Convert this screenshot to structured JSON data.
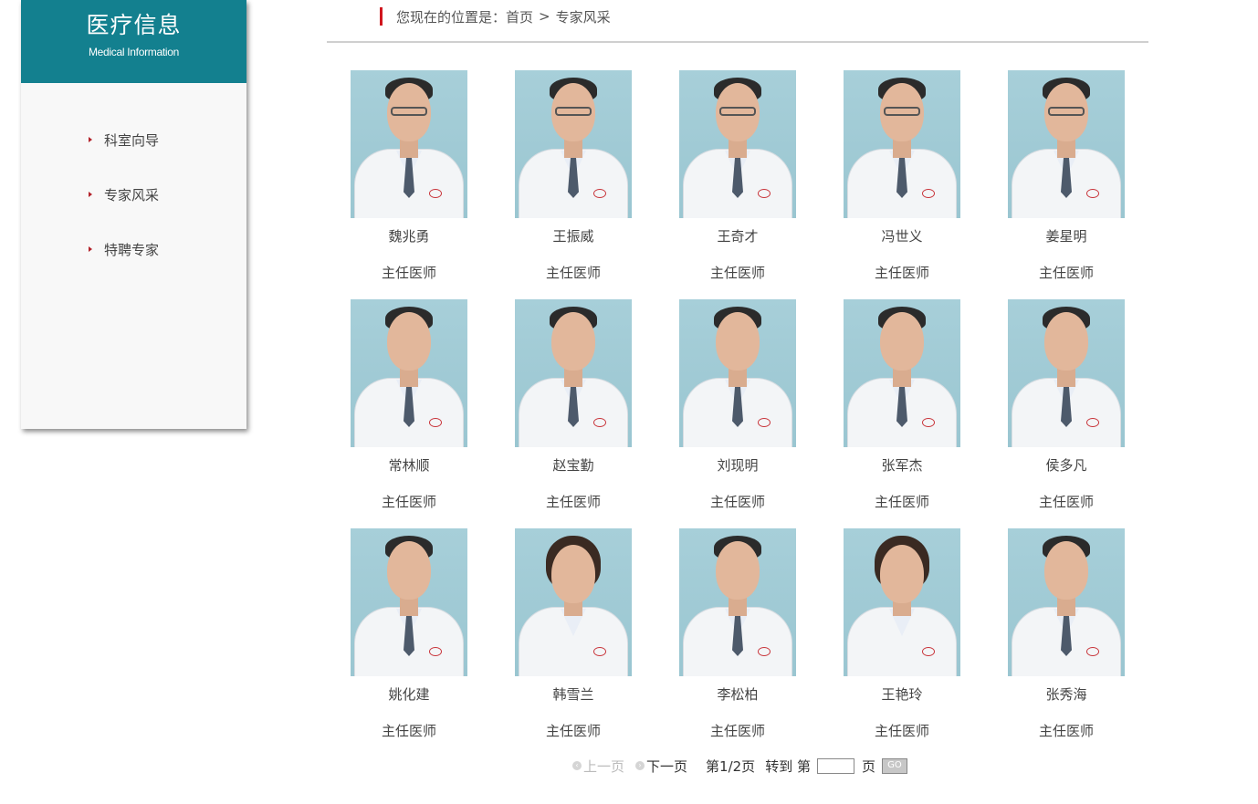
{
  "sidebar": {
    "title": "医疗信息",
    "subtitle": "Medical Information",
    "items": [
      {
        "label": "科室向导"
      },
      {
        "label": "专家风采"
      },
      {
        "label": "特聘专家"
      }
    ]
  },
  "breadcrumb": {
    "prefix": "您现在的位置是：",
    "home": "首页",
    "separator": ">",
    "current": "专家风采"
  },
  "experts": [
    {
      "name": "魏兆勇",
      "title": "主任医师",
      "glasses": true
    },
    {
      "name": "王振威",
      "title": "主任医师",
      "glasses": true
    },
    {
      "name": "王奇才",
      "title": "主任医师",
      "glasses": true
    },
    {
      "name": "冯世义",
      "title": "主任医师",
      "glasses": true
    },
    {
      "name": "姜星明",
      "title": "主任医师",
      "glasses": true
    },
    {
      "name": "常林顺",
      "title": "主任医师"
    },
    {
      "name": "赵宝勤",
      "title": "主任医师"
    },
    {
      "name": "刘现明",
      "title": "主任医师"
    },
    {
      "name": "张军杰",
      "title": "主任医师"
    },
    {
      "name": "侯多凡",
      "title": "主任医师"
    },
    {
      "name": "姚化建",
      "title": "主任医师"
    },
    {
      "name": "韩雪兰",
      "title": "主任医师",
      "female": true
    },
    {
      "name": "李松柏",
      "title": "主任医师"
    },
    {
      "name": "王艳玲",
      "title": "主任医师",
      "female": true
    },
    {
      "name": "张秀海",
      "title": "主任医师"
    }
  ],
  "pagination": {
    "prev_label": "上一页",
    "next_label": "下一页",
    "page_info": "第1/2页",
    "goto_label": "转到 第",
    "page_input_value": "",
    "page_suffix": "页",
    "go_label": "GO"
  }
}
